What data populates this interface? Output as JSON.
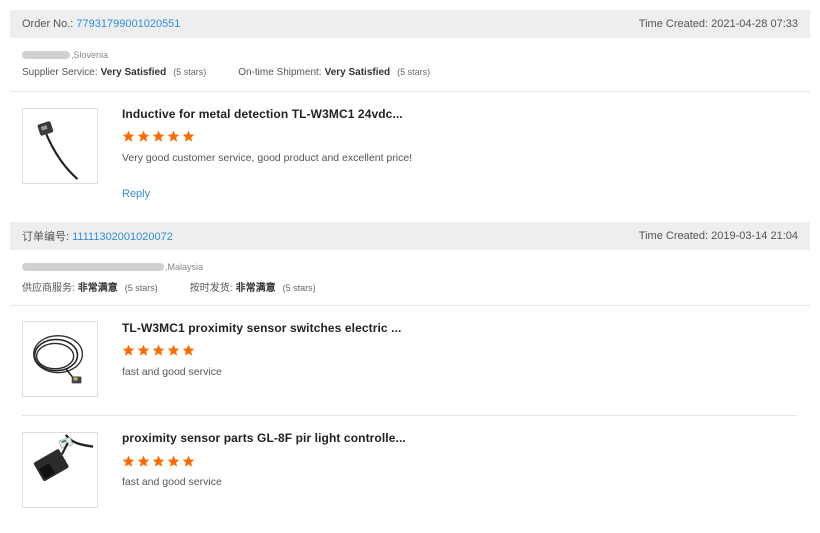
{
  "orders": [
    {
      "order_no_label": "Order No.:",
      "order_no": "77931799001020551",
      "time_label": "Time Created:",
      "time_value": "2021-04-28 07:33",
      "buyer_country": ",Slovenia",
      "supplier_service_label": "Supplier Service:",
      "supplier_service_value": "Very Satisfied",
      "supplier_service_stars": "(5 stars)",
      "shipment_label": "On-time Shipment:",
      "shipment_value": "Very Satisfied",
      "shipment_stars": "(5 stars)",
      "products": [
        {
          "title": "Inductive for metal detection TL-W3MC1 24vdc...",
          "rating": 5,
          "feedback": "Very good customer service, good product and excellent price!",
          "reply_label": "Reply"
        }
      ]
    },
    {
      "order_no_label": "订单编号:",
      "order_no": "11111302001020072",
      "time_label": "Time Created:",
      "time_value": "2019-03-14 21:04",
      "buyer_country": ",Malaysia",
      "supplier_service_label": "供应商服务:",
      "supplier_service_value": "非常满意",
      "supplier_service_stars": "(5 stars)",
      "shipment_label": "按时发货:",
      "shipment_value": "非常满意",
      "shipment_stars": "(5 stars)",
      "products": [
        {
          "title": "TL-W3MC1 proximity sensor switches electric ...",
          "rating": 5,
          "feedback": "fast and good service"
        },
        {
          "title": "proximity sensor parts GL-8F pir light controlle...",
          "rating": 5,
          "feedback": "fast and good service"
        }
      ]
    }
  ],
  "colors": {
    "star": "#ff6a00",
    "link": "#2f8fd8",
    "header_bg": "#eeeeee"
  },
  "icons": {
    "star": "star-icon"
  }
}
